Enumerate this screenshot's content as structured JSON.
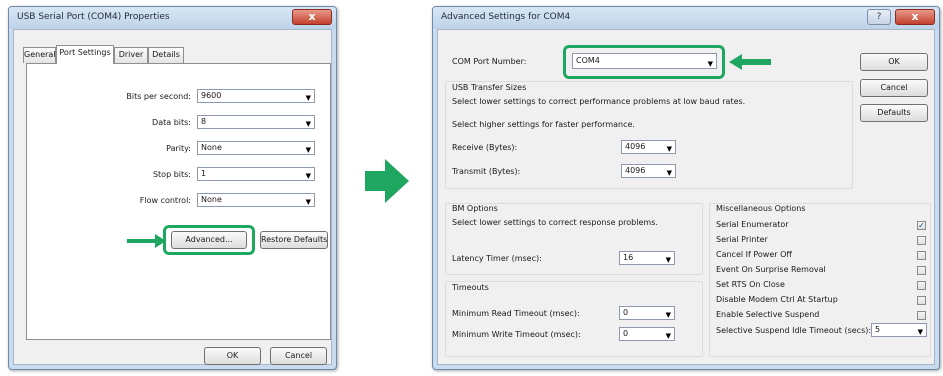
{
  "colors": {
    "highlight": "#1fa660",
    "big_arrow": "#1fa660"
  },
  "properties_dialog": {
    "title": "USB Serial Port (COM4) Properties",
    "close_label": "x",
    "tabs": [
      {
        "label": "General"
      },
      {
        "label": "Port Settings"
      },
      {
        "label": "Driver"
      },
      {
        "label": "Details"
      }
    ],
    "bits_per_second_label": "Bits per second:",
    "bits_per_second_value": "9600",
    "data_bits_label": "Data bits:",
    "data_bits_value": "8",
    "parity_label": "Parity:",
    "parity_value": "None",
    "stop_bits_label": "Stop bits:",
    "stop_bits_value": "1",
    "flow_control_label": "Flow control:",
    "flow_control_value": "None",
    "advanced_button": "Advanced...",
    "restore_defaults_button": "Restore Defaults",
    "ok_button": "OK",
    "cancel_button": "Cancel"
  },
  "advanced_dialog": {
    "title": "Advanced Settings for COM4",
    "help_label": "?",
    "close_label": "x",
    "com_port_label": "COM Port Number:",
    "com_port_value": "COM4",
    "usb_transfer_title": "USB Transfer Sizes",
    "usb_transfer_desc1": "Select lower settings to correct performance problems at low baud rates.",
    "usb_transfer_desc2": "Select higher settings for faster performance.",
    "receive_label": "Receive (Bytes):",
    "receive_value": "4096",
    "transmit_label": "Transmit (Bytes):",
    "transmit_value": "4096",
    "bm_title": "BM Options",
    "bm_desc": "Select lower settings to correct response problems.",
    "latency_label": "Latency Timer (msec):",
    "latency_value": "16",
    "timeouts_title": "Timeouts",
    "min_read_label": "Minimum Read Timeout (msec):",
    "min_read_value": "0",
    "min_write_label": "Minimum Write Timeout (msec):",
    "min_write_value": "0",
    "misc_title": "Miscellaneous Options",
    "misc_options": [
      {
        "label": "Serial Enumerator",
        "checked": true
      },
      {
        "label": "Serial Printer",
        "checked": false
      },
      {
        "label": "Cancel If Power Off",
        "checked": false
      },
      {
        "label": "Event On Surprise Removal",
        "checked": false
      },
      {
        "label": "Set RTS On Close",
        "checked": false
      },
      {
        "label": "Disable Modem Ctrl At Startup",
        "checked": false
      },
      {
        "label": "Enable Selective Suspend",
        "checked": false
      }
    ],
    "selective_suspend_label": "Selective Suspend Idle Timeout (secs):",
    "selective_suspend_value": "5",
    "ok_button": "OK",
    "cancel_button": "Cancel",
    "defaults_button": "Defaults"
  }
}
